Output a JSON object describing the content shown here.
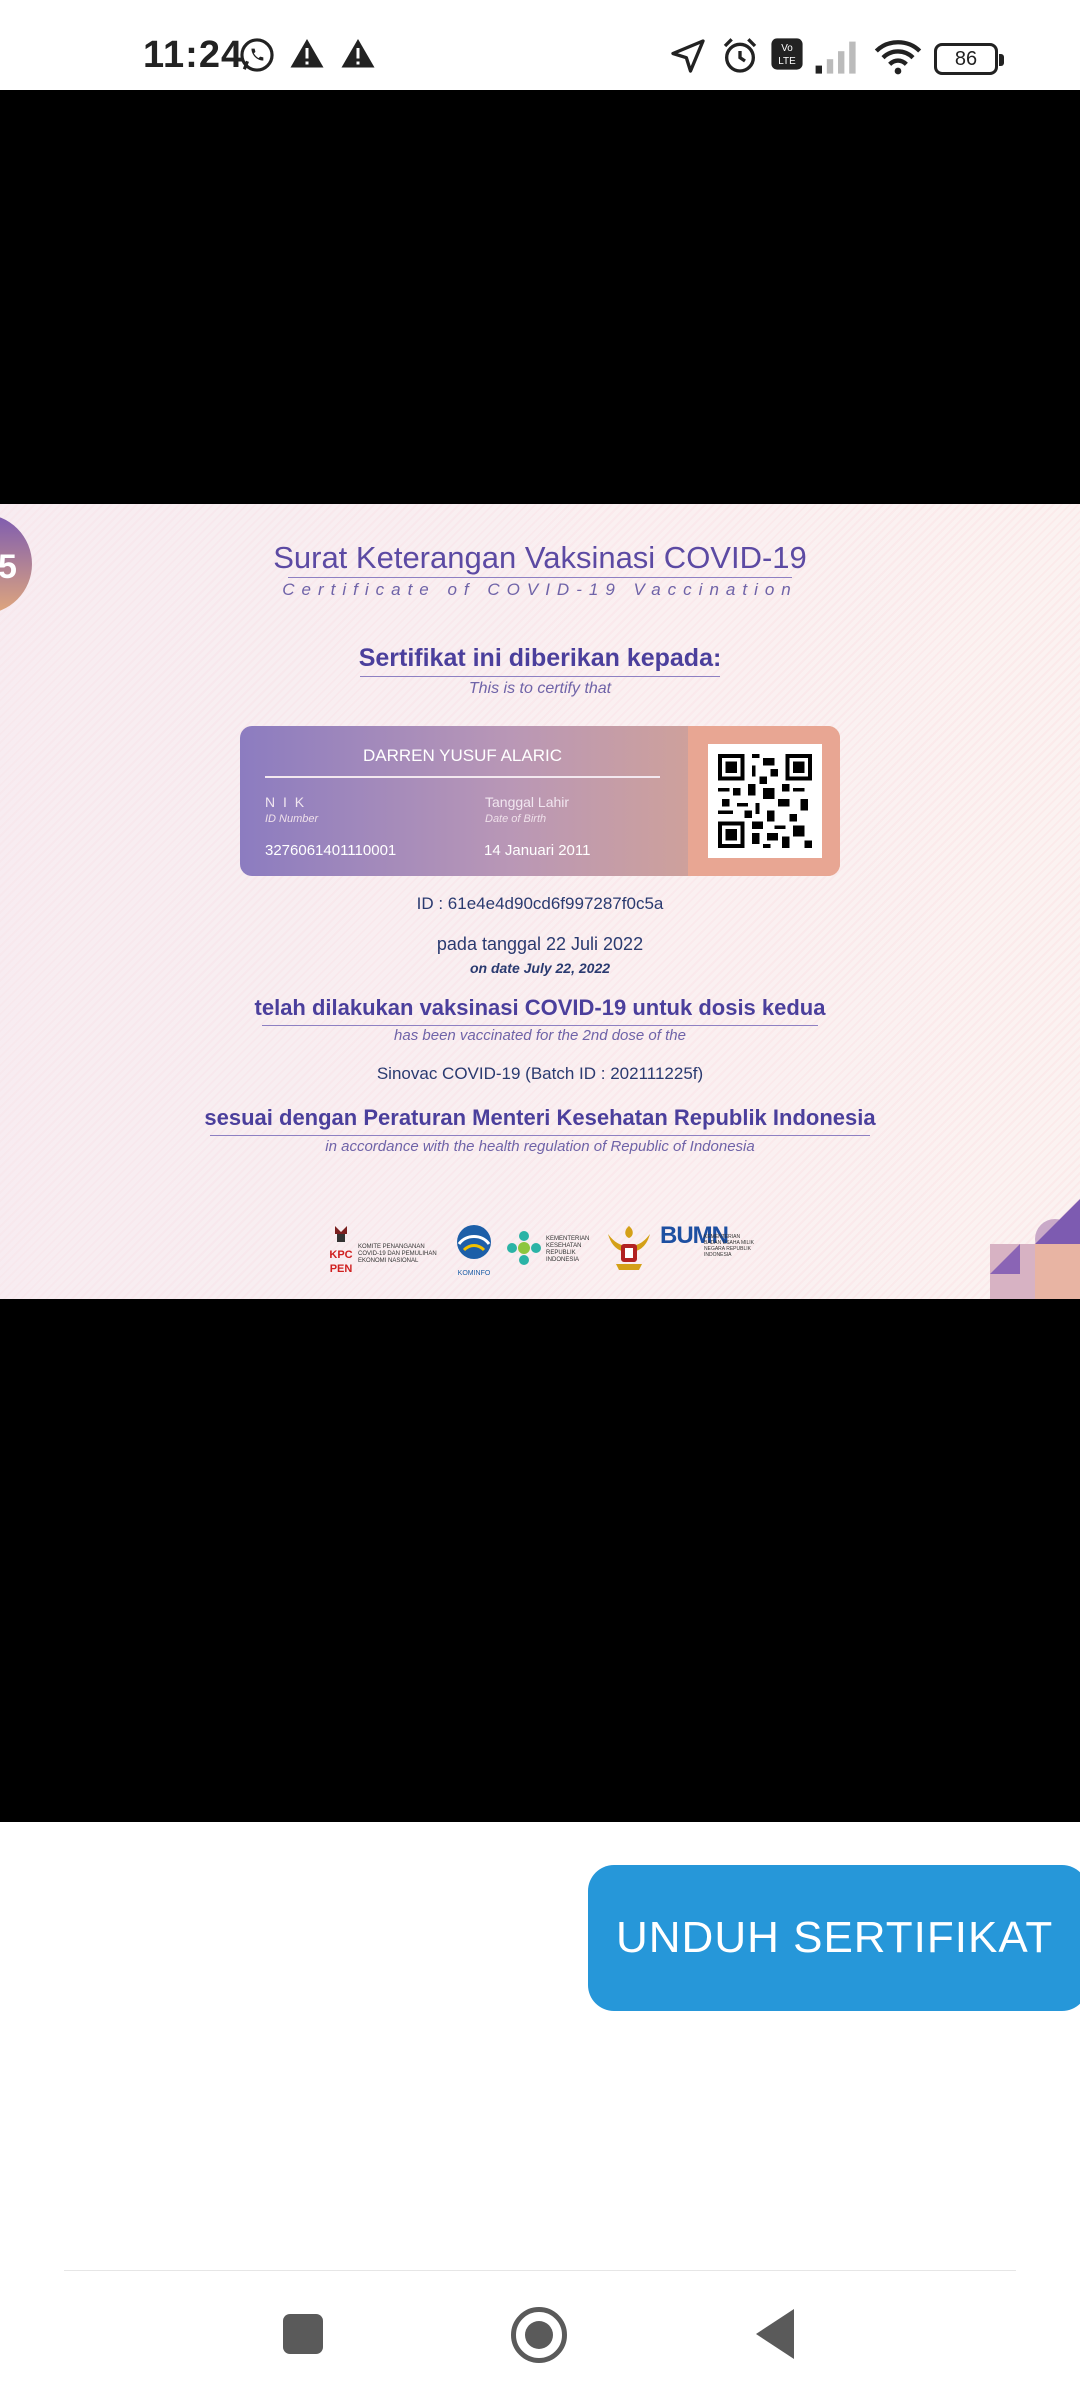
{
  "status_bar": {
    "time": "11:24",
    "battery": "86",
    "icons": [
      "whatsapp-icon",
      "warning-icon",
      "warning-icon",
      "location-icon",
      "alarm-icon",
      "volte-icon",
      "signal-icon",
      "wifi-icon",
      "battery-icon"
    ]
  },
  "certificate": {
    "title": "Surat Keterangan Vaksinasi COVID-19",
    "subtitle": "Certificate of COVID-19 Vaccination",
    "given_to": "Sertifikat ini diberikan kepada:",
    "certify": "This is to certify that",
    "card": {
      "name": "DARREN YUSUF ALARIC",
      "nik_label": "N I K",
      "nik_label_en": "ID Number",
      "nik": "3276061401110001",
      "dob_label": "Tanggal Lahir",
      "dob_label_en": "Date of Birth",
      "dob": "14 Januari 2011"
    },
    "id_line": "ID : 61e4e4d90cd6f997287f0c5a",
    "date_id": "pada tanggal 22 Juli 2022",
    "date_en": "on date July 22, 2022",
    "dose_id": "telah dilakukan vaksinasi COVID-19 untuk dosis kedua",
    "dose_en": "has been vaccinated for the 2nd dose of the",
    "vaccine": "Sinovac COVID-19 (Batch ID : 202111225f)",
    "regulation_id": "sesuai dengan Peraturan Menteri Kesehatan Republik Indonesia",
    "regulation_en": "in accordance with the health regulation of Republic of Indonesia",
    "logos": {
      "kpcpen": "KPC PEN",
      "kpcpen_text": "KOMITE PENANGANAN COVID-19 DAN PEMULIHAN EKONOMI NASIONAL",
      "kominfo": "KOMINFO",
      "kemenkes_text": "KEMENTERIAN KESEHATAN REPUBLIK INDONESIA",
      "bumn": "BUMN",
      "bumn_text": "KEMENTERIAN BADAN USAHA MILIK NEGARA REPUBLIK INDONESIA"
    }
  },
  "actions": {
    "download_label": "UNDUH SERTIFIKAT"
  },
  "colors": {
    "button": "#2697d9",
    "title": "#5c4aa3"
  }
}
